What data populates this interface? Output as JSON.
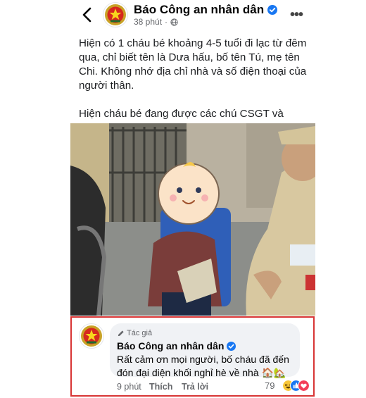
{
  "header": {
    "page_name": "Báo Công an nhân dân",
    "time": "38 phút"
  },
  "post": {
    "paragraph1": "Hiện có 1 cháu bé khoảng 4-5 tuổi đi lạc từ đêm qua, chỉ biết tên là Dưa hấu, bố tên Tú, mẹ tên Chi. Không nhớ địa chỉ nhà và số điện thoại của người thân.",
    "paragraph2": "Hiện cháu bé đang được các chú CSGT và Công an phường Khâm Thiên chăm sóc."
  },
  "comment": {
    "author_badge": "Tác giả",
    "author": "Báo Công an nhân dân",
    "text": "Rất cảm ơn mọi người, bố cháu đã đến đón đại diện khối nghỉ hè về nhà 🏠🏡",
    "time": "9 phút",
    "like_label": "Thích",
    "reply_label": "Trả lời",
    "reaction_count": "79"
  },
  "colors": {
    "verified": "#1877f2",
    "highlight_border": "#d83535",
    "bubble": "#f0f2f5"
  },
  "icons": [
    "back-chevron-icon",
    "verified-badge-icon",
    "globe-icon",
    "more-dots-icon",
    "pen-icon",
    "haha-reaction-icon",
    "like-reaction-icon",
    "love-reaction-icon"
  ]
}
